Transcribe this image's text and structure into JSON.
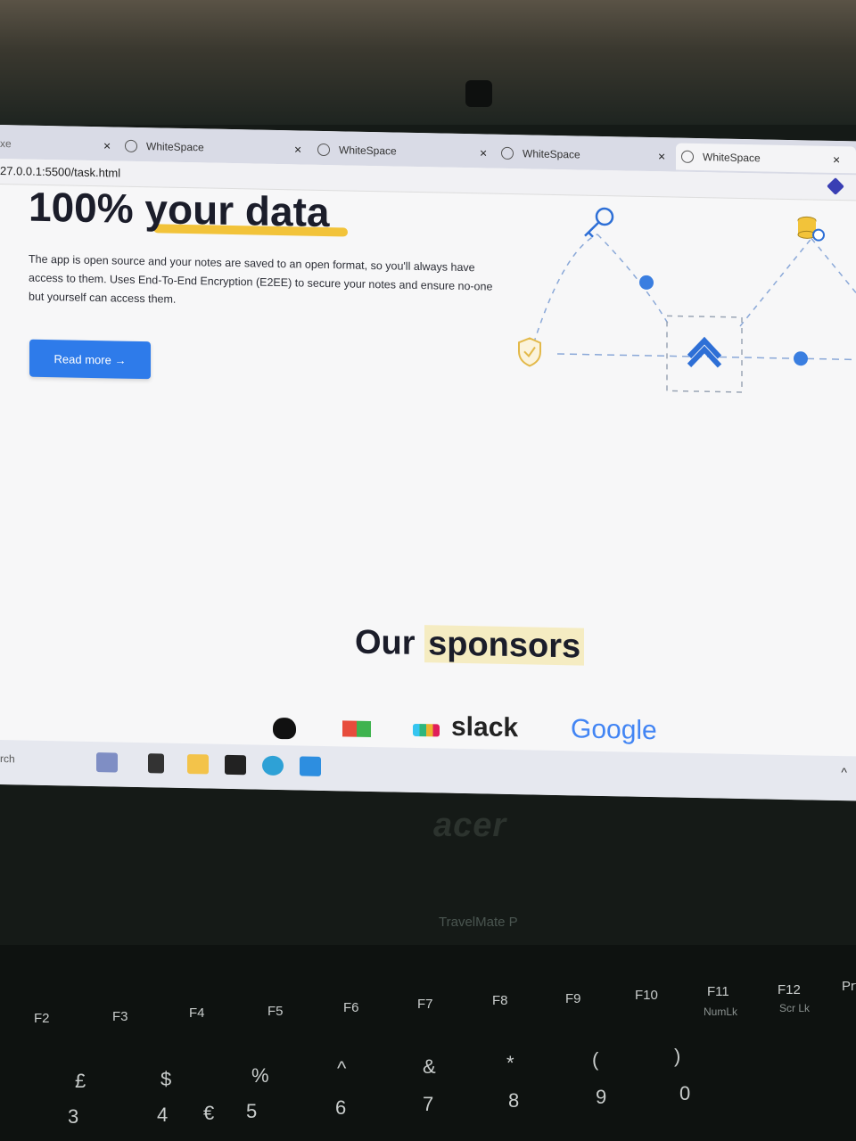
{
  "browser": {
    "tabs": [
      {
        "label": "xe"
      },
      {
        "label": "WhiteSpace"
      },
      {
        "label": "WhiteSpace"
      },
      {
        "label": "WhiteSpace"
      },
      {
        "label": "WhiteSpace"
      }
    ],
    "close_glyph": "×",
    "url": "27.0.0.1:5500/task.html"
  },
  "hero": {
    "title": "100% your data",
    "description": "The app is open source and your notes are saved to an open format, so you'll always have access to them. Uses End-To-End Encryption (E2EE) to secure your notes and ensure no-one but yourself can access them.",
    "button_label": "Read more →",
    "highlight_color": "#f2c33a",
    "button_color": "#2e7bea"
  },
  "sponsors": {
    "title_plain": "Our",
    "title_highlight": "sponsors",
    "logos": [
      "slack",
      "Google"
    ]
  },
  "taskbar": {
    "search_text": "rch"
  },
  "laptop": {
    "brand": "acer",
    "model": "TravelMate P"
  },
  "keyboard": {
    "fkeys": [
      "F2",
      "F3",
      "F4",
      "F5",
      "F6",
      "F7",
      "F8",
      "F9",
      "F10",
      "F11",
      "F12",
      "Prt"
    ],
    "sublabels": [
      "NumLk",
      "Scr Lk"
    ],
    "symbols": [
      "£",
      "$",
      "%",
      "^",
      "&",
      "*",
      "(",
      ")",
      "7",
      "8",
      "9"
    ],
    "numbers": [
      "3",
      "4",
      "€",
      "5",
      "6",
      "7",
      "8",
      "9",
      "0"
    ]
  }
}
